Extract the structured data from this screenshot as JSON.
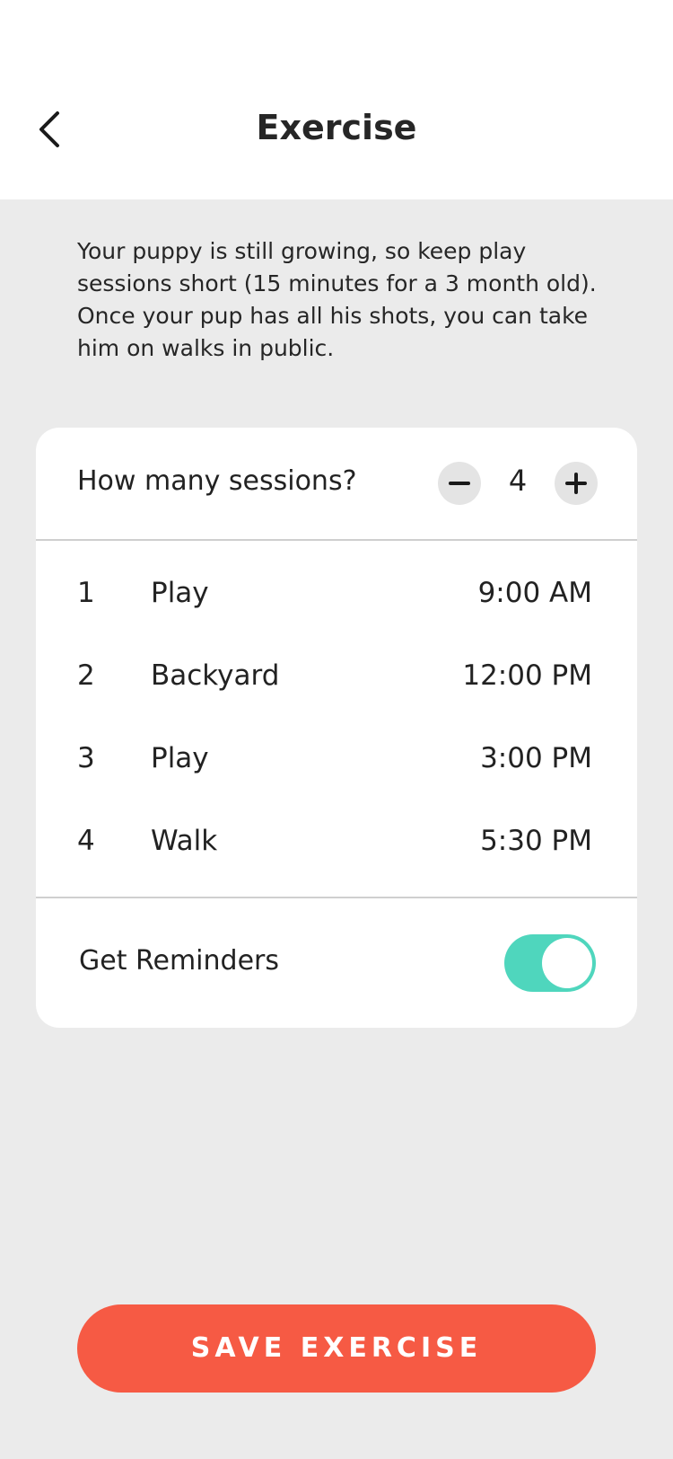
{
  "header": {
    "title": "Exercise",
    "back_icon": "chevron-left-icon"
  },
  "intro": {
    "text": "Your puppy is still growing, so keep play sessions short (15 minutes for a 3 month old). Once your pup has all his shots, you can take him on walks in public."
  },
  "sessions": {
    "label": "How many sessions?",
    "count": "4",
    "minus_icon": "minus-icon",
    "plus_icon": "plus-icon",
    "items": [
      {
        "number": "1",
        "activity": "Play",
        "time": "9:00 AM"
      },
      {
        "number": "2",
        "activity": "Backyard",
        "time": "12:00 PM"
      },
      {
        "number": "3",
        "activity": "Play",
        "time": "3:00 PM"
      },
      {
        "number": "4",
        "activity": "Walk",
        "time": "5:30 PM"
      }
    ]
  },
  "reminders": {
    "label": "Get Reminders",
    "enabled": true
  },
  "save_button": {
    "label": "SAVE EXERCISE"
  },
  "colors": {
    "accent": "#f65a44",
    "toggle_on": "#4fd6bd",
    "background": "#ebebeb"
  }
}
